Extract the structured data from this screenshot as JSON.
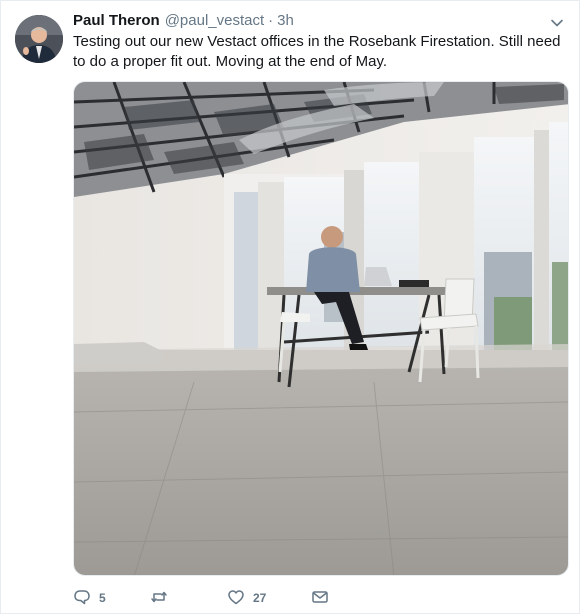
{
  "tweet": {
    "author_name": "Paul Theron",
    "author_handle": "@paul_vestact",
    "separator": "·",
    "time": "3h",
    "text": "Testing out our new Vestact offices in the Rosebank Firestation. Still need to do a proper fit out. Moving at the end of May."
  },
  "actions": {
    "reply_count": "5",
    "retweet_count": "",
    "like_count": "27"
  },
  "icons": {
    "caret": "chevron-down-icon",
    "reply": "reply-icon",
    "retweet": "retweet-icon",
    "like": "heart-icon",
    "dm": "envelope-icon"
  },
  "colors": {
    "text": "#14171a",
    "secondary": "#657786",
    "border": "#e6ecf0"
  }
}
